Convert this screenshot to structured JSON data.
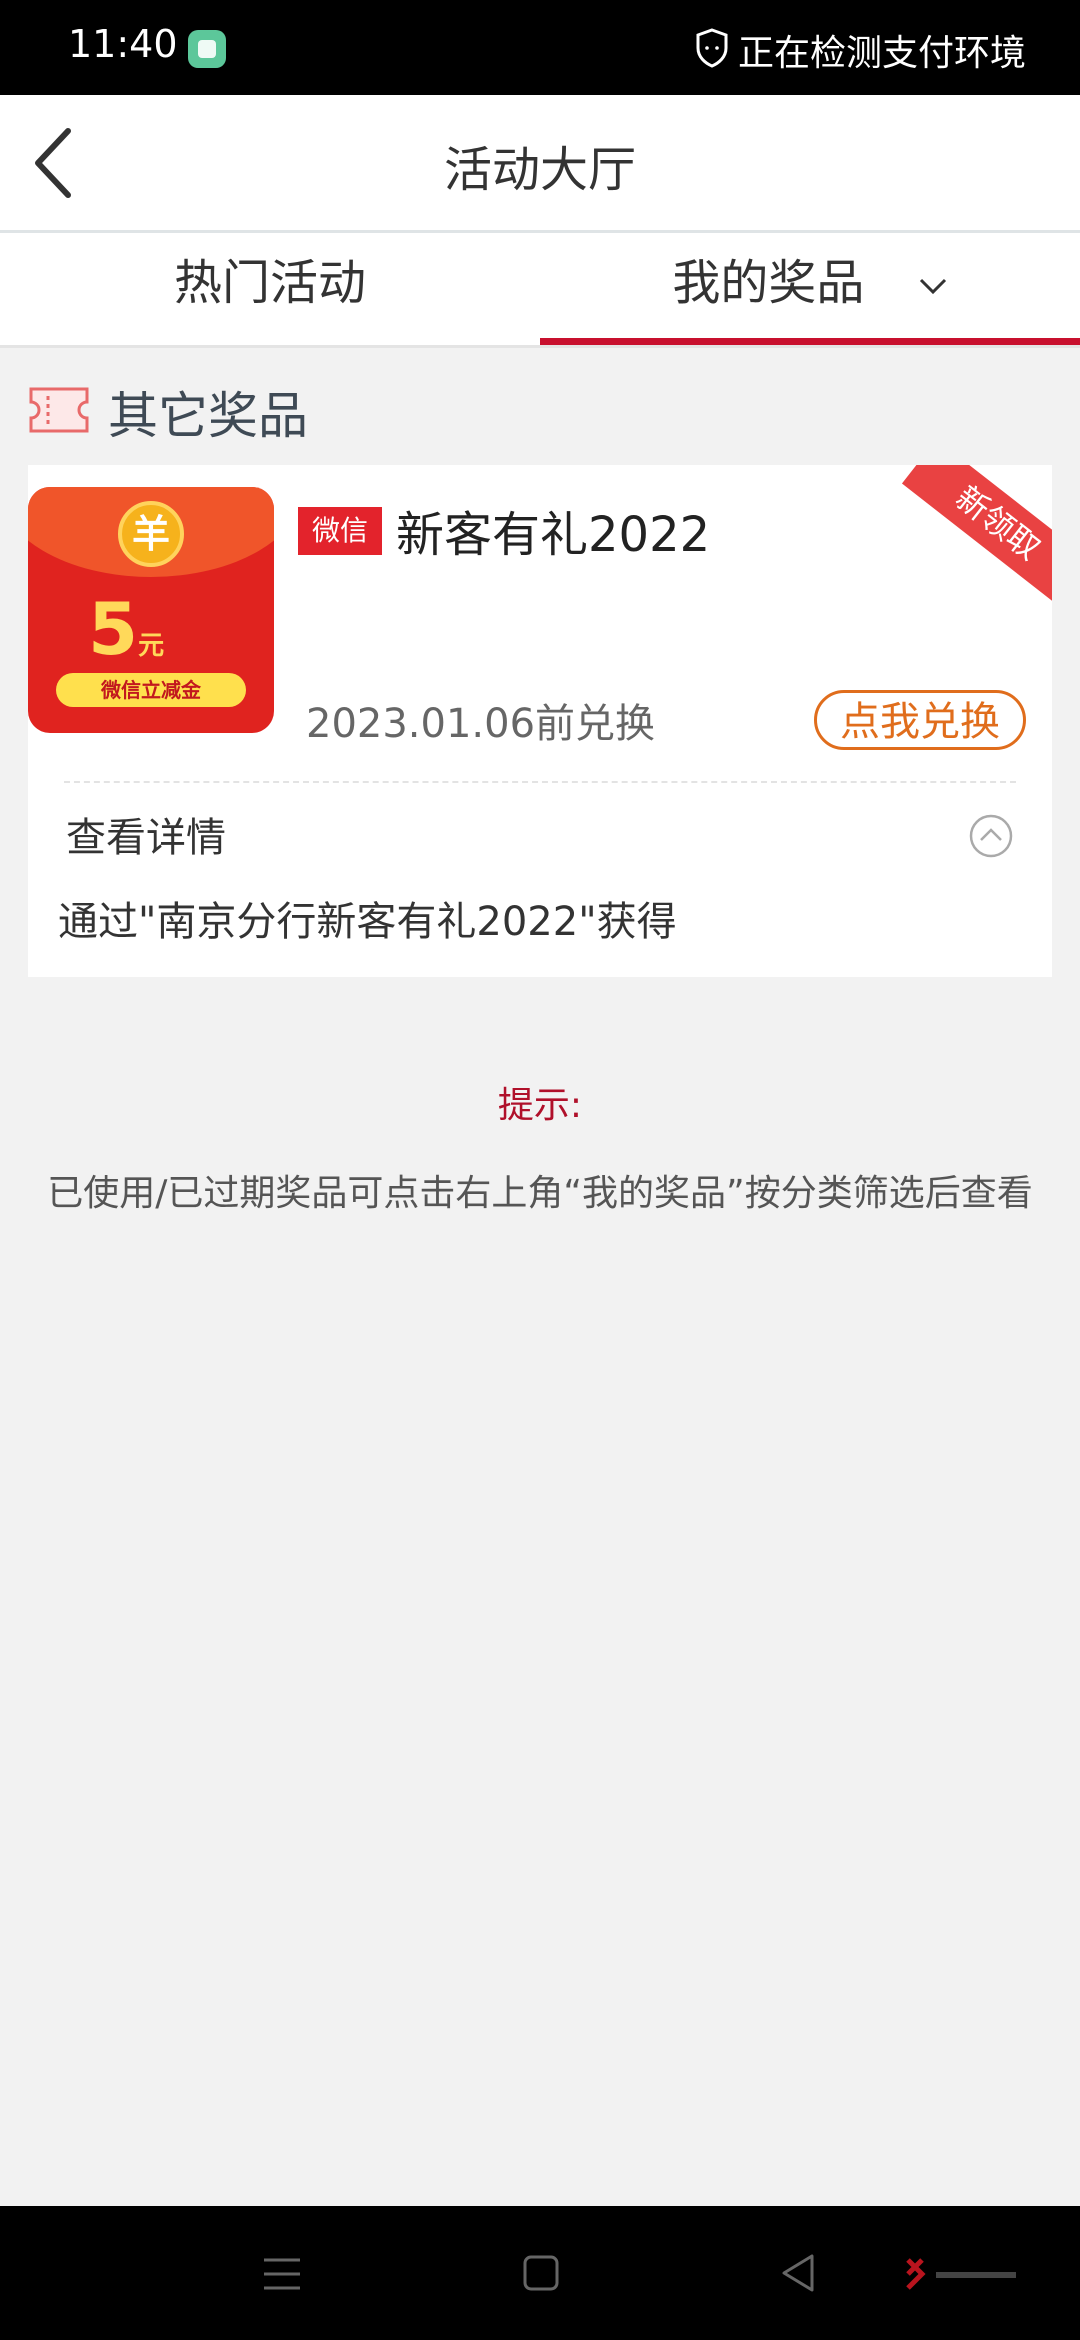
{
  "status_bar": {
    "time": "11:40",
    "status_text": "正在检测支付环境"
  },
  "header": {
    "title": "活动大厅"
  },
  "tabs": {
    "hot": "热门活动",
    "mine": "我的奖品",
    "active": "mine"
  },
  "section": {
    "title": "其它奖品"
  },
  "prize": {
    "image": {
      "coin_symbol": "羊",
      "amount": "5",
      "unit": "元",
      "label": "微信立减金"
    },
    "platform_badge": "微信",
    "name": "新客有礼2022",
    "corner_tag": "新领取",
    "deadline": "2023.01.06前兑换",
    "redeem_label": "点我兑换",
    "detail_label": "查看详情",
    "detail_text": "通过\"南京分行新客有礼2022\"获得"
  },
  "tip": {
    "title": "提示:",
    "text": "已使用/已过期奖品可点击右上角“我的奖品”按分类筛选后查看"
  },
  "colors": {
    "accent_red": "#c8102e",
    "redeem_orange": "#e06d1c",
    "background": "#f2f2f2"
  },
  "icons": [
    "back-arrow-icon",
    "chevron-down-icon",
    "ticket-icon",
    "chevron-up-circle-icon",
    "shield-icon",
    "menu-icon",
    "home-icon",
    "back-icon"
  ]
}
